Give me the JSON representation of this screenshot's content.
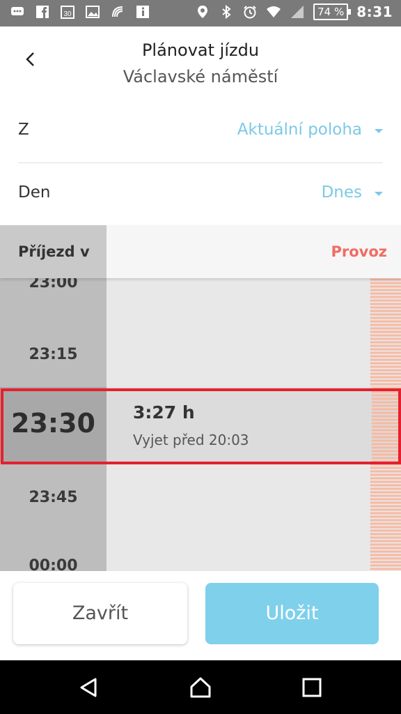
{
  "status_bar": {
    "battery": "74 %",
    "time": "8:31",
    "left_icons": [
      "chat-icon",
      "facebook-icon",
      "calendar-icon",
      "image-icon",
      "nfc-icon",
      "info-icon"
    ],
    "right_icons": [
      "location-icon",
      "bluetooth-icon",
      "alarm-icon",
      "wifi-icon",
      "signal-icon"
    ]
  },
  "header": {
    "title": "Plánovat jízdu",
    "subtitle": "Václavské náměstí"
  },
  "form": {
    "from_label": "Z",
    "from_value": "Aktuální poloha",
    "day_label": "Den",
    "day_value": "Dnes"
  },
  "timeline": {
    "arrival_header": "Příjezd v",
    "traffic_header": "Provoz",
    "times": [
      "23:00",
      "23:15",
      "23:45",
      "00:00"
    ],
    "selected": {
      "time": "23:30",
      "duration": "3:27 h",
      "depart": "Vyjet před 20:03"
    }
  },
  "buttons": {
    "close": "Zavřít",
    "save": "Uložit"
  },
  "colors": {
    "accent": "#7cc9e6",
    "traffic": "#f06c63",
    "highlight": "#e5202e"
  }
}
